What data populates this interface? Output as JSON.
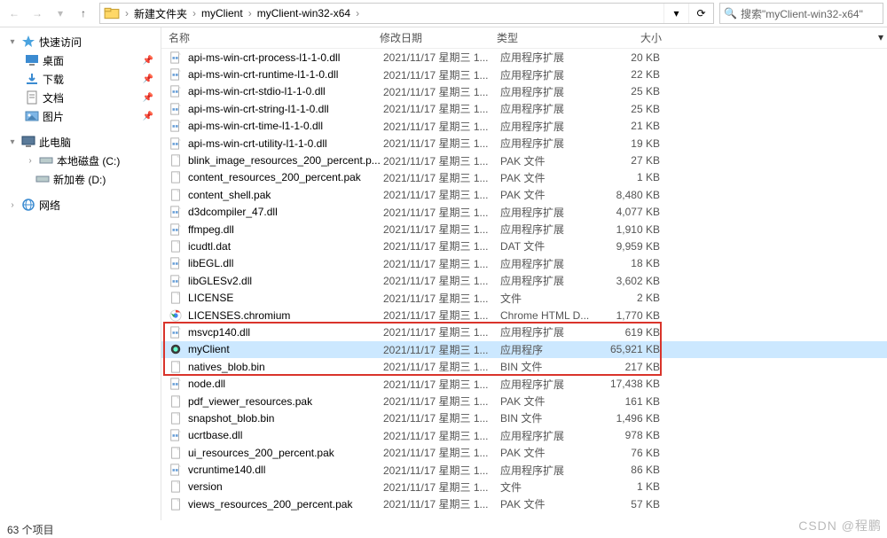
{
  "toolbar": {
    "breadcrumbs": [
      "新建文件夹",
      "myClient",
      "myClient-win32-x64"
    ],
    "search_placeholder": "搜索\"myClient-win32-x64\""
  },
  "sidebar": {
    "quick_access": "快速访问",
    "items": [
      {
        "label": "桌面",
        "pinned": true
      },
      {
        "label": "下载",
        "pinned": true
      },
      {
        "label": "文档",
        "pinned": true
      },
      {
        "label": "图片",
        "pinned": true
      }
    ],
    "this_pc": "此电脑",
    "drives": [
      {
        "label": "本地磁盘 (C:)"
      },
      {
        "label": "新加卷 (D:)"
      }
    ],
    "network": "网络"
  },
  "columns": {
    "name": "名称",
    "date": "修改日期",
    "type": "类型",
    "size": "大小"
  },
  "files": [
    {
      "icon": "dll",
      "name": "api-ms-win-crt-process-l1-1-0.dll",
      "date": "2021/11/17 星期三 1...",
      "type": "应用程序扩展",
      "size": "20 KB"
    },
    {
      "icon": "dll",
      "name": "api-ms-win-crt-runtime-l1-1-0.dll",
      "date": "2021/11/17 星期三 1...",
      "type": "应用程序扩展",
      "size": "22 KB"
    },
    {
      "icon": "dll",
      "name": "api-ms-win-crt-stdio-l1-1-0.dll",
      "date": "2021/11/17 星期三 1...",
      "type": "应用程序扩展",
      "size": "25 KB"
    },
    {
      "icon": "dll",
      "name": "api-ms-win-crt-string-l1-1-0.dll",
      "date": "2021/11/17 星期三 1...",
      "type": "应用程序扩展",
      "size": "25 KB"
    },
    {
      "icon": "dll",
      "name": "api-ms-win-crt-time-l1-1-0.dll",
      "date": "2021/11/17 星期三 1...",
      "type": "应用程序扩展",
      "size": "21 KB"
    },
    {
      "icon": "dll",
      "name": "api-ms-win-crt-utility-l1-1-0.dll",
      "date": "2021/11/17 星期三 1...",
      "type": "应用程序扩展",
      "size": "19 KB"
    },
    {
      "icon": "file",
      "name": "blink_image_resources_200_percent.p...",
      "date": "2021/11/17 星期三 1...",
      "type": "PAK 文件",
      "size": "27 KB"
    },
    {
      "icon": "file",
      "name": "content_resources_200_percent.pak",
      "date": "2021/11/17 星期三 1...",
      "type": "PAK 文件",
      "size": "1 KB"
    },
    {
      "icon": "file",
      "name": "content_shell.pak",
      "date": "2021/11/17 星期三 1...",
      "type": "PAK 文件",
      "size": "8,480 KB"
    },
    {
      "icon": "dll",
      "name": "d3dcompiler_47.dll",
      "date": "2021/11/17 星期三 1...",
      "type": "应用程序扩展",
      "size": "4,077 KB"
    },
    {
      "icon": "dll",
      "name": "ffmpeg.dll",
      "date": "2021/11/17 星期三 1...",
      "type": "应用程序扩展",
      "size": "1,910 KB"
    },
    {
      "icon": "file",
      "name": "icudtl.dat",
      "date": "2021/11/17 星期三 1...",
      "type": "DAT 文件",
      "size": "9,959 KB"
    },
    {
      "icon": "dll",
      "name": "libEGL.dll",
      "date": "2021/11/17 星期三 1...",
      "type": "应用程序扩展",
      "size": "18 KB"
    },
    {
      "icon": "dll",
      "name": "libGLESv2.dll",
      "date": "2021/11/17 星期三 1...",
      "type": "应用程序扩展",
      "size": "3,602 KB"
    },
    {
      "icon": "file",
      "name": "LICENSE",
      "date": "2021/11/17 星期三 1...",
      "type": "文件",
      "size": "2 KB"
    },
    {
      "icon": "chrome",
      "name": "LICENSES.chromium",
      "date": "2021/11/17 星期三 1...",
      "type": "Chrome HTML D...",
      "size": "1,770 KB"
    },
    {
      "icon": "dll",
      "name": "msvcp140.dll",
      "date": "2021/11/17 星期三 1...",
      "type": "应用程序扩展",
      "size": "619 KB"
    },
    {
      "icon": "exe",
      "name": "myClient",
      "date": "2021/11/17 星期三 1...",
      "type": "应用程序",
      "size": "65,921 KB",
      "selected": true
    },
    {
      "icon": "file",
      "name": "natives_blob.bin",
      "date": "2021/11/17 星期三 1...",
      "type": "BIN 文件",
      "size": "217 KB"
    },
    {
      "icon": "dll",
      "name": "node.dll",
      "date": "2021/11/17 星期三 1...",
      "type": "应用程序扩展",
      "size": "17,438 KB"
    },
    {
      "icon": "file",
      "name": "pdf_viewer_resources.pak",
      "date": "2021/11/17 星期三 1...",
      "type": "PAK 文件",
      "size": "161 KB"
    },
    {
      "icon": "file",
      "name": "snapshot_blob.bin",
      "date": "2021/11/17 星期三 1...",
      "type": "BIN 文件",
      "size": "1,496 KB"
    },
    {
      "icon": "dll",
      "name": "ucrtbase.dll",
      "date": "2021/11/17 星期三 1...",
      "type": "应用程序扩展",
      "size": "978 KB"
    },
    {
      "icon": "file",
      "name": "ui_resources_200_percent.pak",
      "date": "2021/11/17 星期三 1...",
      "type": "PAK 文件",
      "size": "76 KB"
    },
    {
      "icon": "dll",
      "name": "vcruntime140.dll",
      "date": "2021/11/17 星期三 1...",
      "type": "应用程序扩展",
      "size": "86 KB"
    },
    {
      "icon": "file",
      "name": "version",
      "date": "2021/11/17 星期三 1...",
      "type": "文件",
      "size": "1 KB"
    },
    {
      "icon": "file",
      "name": "views_resources_200_percent.pak",
      "date": "2021/11/17 星期三 1...",
      "type": "PAK 文件",
      "size": "57 KB"
    }
  ],
  "status": "63 个项目",
  "watermark": "CSDN @程鹏",
  "highlight_row_name": "myClient",
  "red_box_index_range": [
    16,
    18
  ]
}
